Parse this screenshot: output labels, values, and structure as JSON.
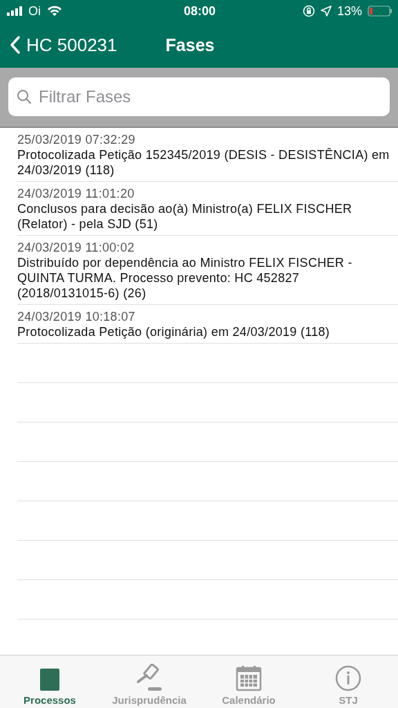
{
  "status_bar": {
    "carrier": "Oi",
    "time": "08:00",
    "battery": "13%"
  },
  "nav": {
    "back": "HC 500231",
    "title": "Fases"
  },
  "search": {
    "placeholder": "Filtrar Fases"
  },
  "phases": [
    {
      "datetime": "25/03/2019 07:32:29",
      "text": "Protocolizada Petição 152345/2019 (DESIS - DESISTÊNCIA) em 24/03/2019 (118)"
    },
    {
      "datetime": "24/03/2019 11:01:20",
      "text": "Conclusos para decisão ao(à) Ministro(a) FELIX FISCHER (Relator) - pela SJD (51)"
    },
    {
      "datetime": "24/03/2019 11:00:02",
      "text": "Distribuído por dependência ao Ministro FELIX FISCHER - QUINTA TURMA. Processo prevento: HC 452827 (2018/0131015-6) (26)"
    },
    {
      "datetime": "24/03/2019 10:18:07",
      "text": "Protocolizada Petição (originária) em 24/03/2019 (118)"
    }
  ],
  "tabs": [
    {
      "kind": "square",
      "label": "Processos",
      "selected": true
    },
    {
      "kind": "gavel",
      "label": "Jurisprudência",
      "selected": false
    },
    {
      "kind": "calendar",
      "label": "Calendário",
      "selected": false
    },
    {
      "kind": "info",
      "label": "STJ",
      "selected": false
    }
  ]
}
